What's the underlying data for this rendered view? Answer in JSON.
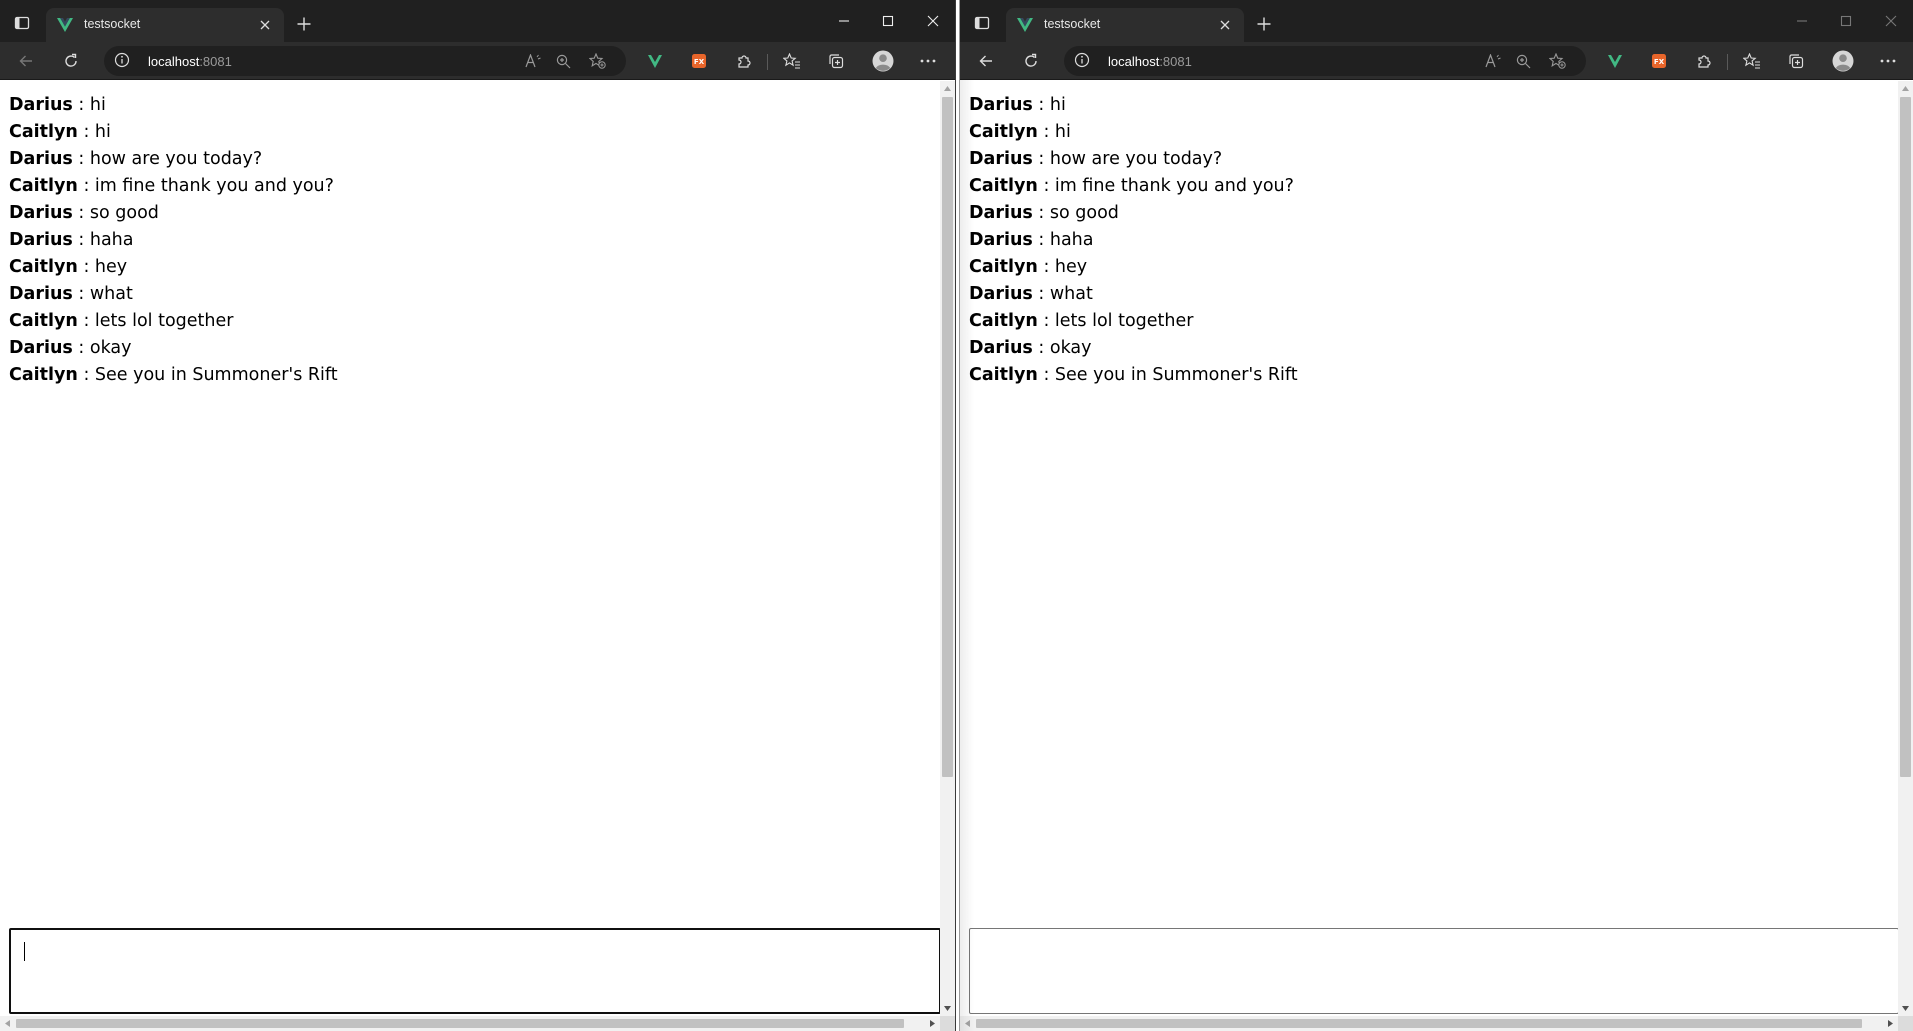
{
  "windows": [
    {
      "id": "left",
      "tab_title": "testsocket",
      "url_host": "localhost",
      "url_port": ":8081",
      "input_value": "",
      "focused": true
    },
    {
      "id": "right",
      "tab_title": "testsocket",
      "url_host": "localhost",
      "url_port": ":8081",
      "input_value": "",
      "focused": false
    }
  ],
  "messages": [
    {
      "sender": "Darius",
      "text": " : hi"
    },
    {
      "sender": "Caitlyn",
      "text": " : hi"
    },
    {
      "sender": "Darius",
      "text": " : how are you today?"
    },
    {
      "sender": "Caitlyn",
      "text": " : im fine thank you and you?"
    },
    {
      "sender": "Darius",
      "text": " : so good"
    },
    {
      "sender": "Darius",
      "text": " : haha"
    },
    {
      "sender": "Caitlyn",
      "text": " : hey"
    },
    {
      "sender": "Darius",
      "text": " : what"
    },
    {
      "sender": "Caitlyn",
      "text": " : lets lol together"
    },
    {
      "sender": "Darius",
      "text": " : okay"
    },
    {
      "sender": "Caitlyn",
      "text": " : See you in Summoner's Rift"
    }
  ],
  "icons": {
    "tab_actions": "tab-actions-icon",
    "favicon": "vue-logo-icon",
    "tab_close": "close-icon",
    "new_tab": "plus-icon",
    "minimize": "minimize-icon",
    "maximize": "maximize-icon",
    "close_window": "close-icon",
    "back": "back-arrow-icon",
    "refresh": "refresh-icon",
    "site_info": "info-icon",
    "read_aloud": "read-aloud-icon",
    "zoom": "zoom-icon",
    "add_favorite": "add-favorite-icon",
    "vue_devtools": "vue-devtools-icon",
    "fx_extension": "fx-extension-icon",
    "extensions": "extensions-puzzle-icon",
    "favorites": "favorites-icon",
    "collections": "collections-icon",
    "profile": "profile-avatar-icon",
    "more": "more-menu-icon"
  },
  "colors": {
    "titlebar": "#202020",
    "toolbar": "#2d2d2d",
    "vue_green": "#41b883",
    "fx_orange": "#e8652a"
  }
}
